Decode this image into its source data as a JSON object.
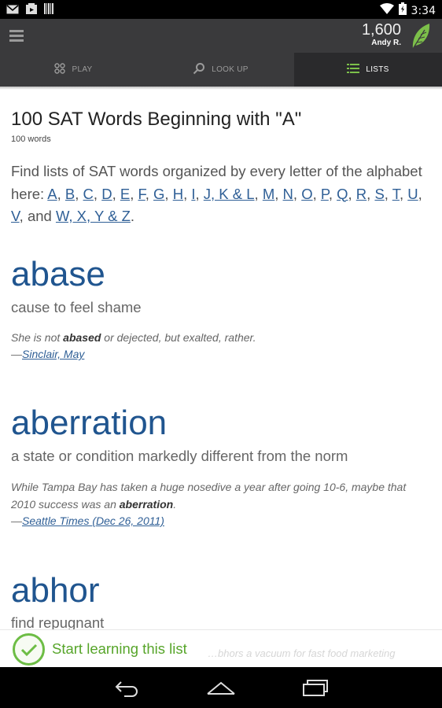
{
  "status_bar": {
    "time": "3:34",
    "icons": [
      "gmail-icon",
      "youtube-icon",
      "barcode-icon",
      "wifi-icon",
      "battery-icon"
    ]
  },
  "app_bar": {
    "points": "1,600",
    "user": "Andy R.",
    "leaf_color": "#7cc04a"
  },
  "tabs": [
    {
      "label": "PLAY",
      "icon": "grid-icon"
    },
    {
      "label": "LOOK UP",
      "icon": "search-icon"
    },
    {
      "label": "LISTS",
      "icon": "list-icon",
      "active": true
    }
  ],
  "list": {
    "title": "100 SAT Words Beginning with \"A\"",
    "count": "100 words",
    "intro_prefix": "Find lists of SAT words organized by every letter of the alphabet here: ",
    "letter_links": [
      "A",
      "B",
      "C",
      "D",
      "E",
      "F",
      "G",
      "H",
      "I",
      "J, K & L",
      "M",
      "N",
      "O",
      "P",
      "Q",
      "R",
      "S",
      "T",
      "U",
      "V"
    ],
    "intro_and": "and ",
    "last_link": "W, X, Y & Z",
    "intro_end": "."
  },
  "entries": [
    {
      "word": "abase",
      "definition": "cause to feel shame",
      "example_before": "She is not ",
      "example_bold": "abased",
      "example_after": " or dejected, but exalted, rather.",
      "source": "Sinclair, May"
    },
    {
      "word": "aberration",
      "definition": "a state or condition markedly different from the norm",
      "example_before": "While Tampa Bay has taken a huge nosedive a year after going 10-6, maybe that 2010 success was an ",
      "example_bold": "aberration",
      "example_after": ".",
      "source": "Seattle Times (Dec 26, 2011)"
    },
    {
      "word": "abhor",
      "definition": "find repugnant",
      "example_partial": "…bhors a vacuum for fast food marketing"
    }
  ],
  "learn_bar": {
    "label": "Start learning this list",
    "accent": "#6dbd45"
  },
  "source_dash": "—",
  "colors": {
    "word_blue": "#20558f",
    "link_blue": "#2f5f96",
    "appbar": "#3a3a3c"
  }
}
